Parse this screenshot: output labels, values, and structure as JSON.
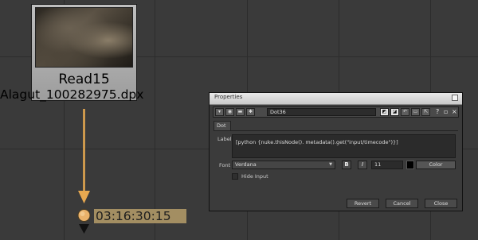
{
  "node": {
    "name": "Read15",
    "file": "Alagut_100282975.dpx",
    "thumbnail_icon": "film-frame-thumbnail"
  },
  "dot": {
    "timecode": "03:16:30:15",
    "connector_color": "#e8a950",
    "timecode_bg": "#a38e62"
  },
  "properties": {
    "window_title": "Properties",
    "node_name": "Dot36",
    "tab": "Dot",
    "label_caption": "Label",
    "label_value": "[python {nuke.thisNode(). metadata().get(\"input/timecode\")}]",
    "font_caption": "Font",
    "font_value": "Verdana",
    "bold_label": "B",
    "italic_label": "I",
    "font_size": "11",
    "color_button": "Color",
    "hide_input_label": "Hide Input",
    "buttons": {
      "revert": "Revert",
      "cancel": "Cancel",
      "close": "Close"
    },
    "toolbar_help": "?"
  },
  "colors": {
    "background": "#3a3a3a",
    "grid": "#2c2c2c",
    "node_body": "#b0b0b0"
  }
}
